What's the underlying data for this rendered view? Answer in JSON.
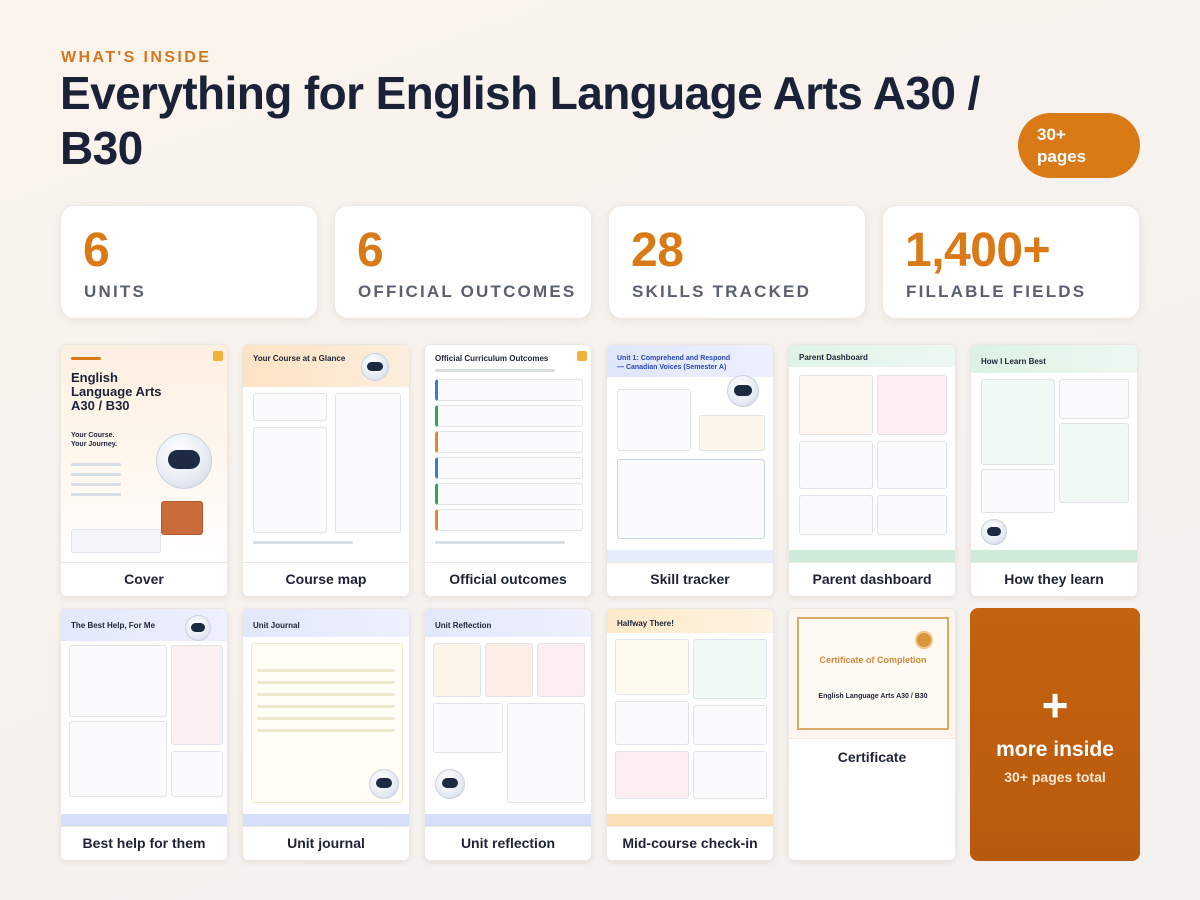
{
  "header": {
    "eyebrow": "WHAT'S INSIDE",
    "title": "Everything for English Language Arts A30 / B30",
    "badge_line1": "30+",
    "badge_line2": "pages"
  },
  "stats": [
    {
      "value": "6",
      "label": "UNITS"
    },
    {
      "value": "6",
      "label": "OFFICIAL OUTCOMES"
    },
    {
      "value": "28",
      "label": "SKILLS TRACKED"
    },
    {
      "value": "1,400+",
      "label": "FILLABLE FIELDS"
    }
  ],
  "cards": [
    {
      "caption": "Cover",
      "thumb_title": "English Language Arts A30 / B30",
      "thumb_sub": "Your Course. Your Journey."
    },
    {
      "caption": "Course map",
      "thumb_title": "Your Course at a Glance"
    },
    {
      "caption": "Official outcomes",
      "thumb_title": "Official Curriculum Outcomes"
    },
    {
      "caption": "Skill tracker",
      "thumb_title": "Unit 1: Comprehend and Respond — Canadian Voices (Semester A)"
    },
    {
      "caption": "Parent dashboard",
      "thumb_title": "Parent Dashboard"
    },
    {
      "caption": "How they learn",
      "thumb_title": "How I Learn Best"
    },
    {
      "caption": "Best help for them",
      "thumb_title": "The Best Help, For Me"
    },
    {
      "caption": "Unit journal",
      "thumb_title": "Unit Journal"
    },
    {
      "caption": "Unit reflection",
      "thumb_title": "Unit Reflection"
    },
    {
      "caption": "Mid-course check-in",
      "thumb_title": "Halfway There!"
    }
  ],
  "certificate": {
    "caption": "Certificate",
    "title": "Certificate of Completion",
    "subtitle": "English Language Arts A30 / B30"
  },
  "more": {
    "plus": "+",
    "title": "more inside",
    "subtitle": "30+ pages total"
  },
  "colors": {
    "accent": "#d97a17",
    "dark": "#1b2237"
  }
}
